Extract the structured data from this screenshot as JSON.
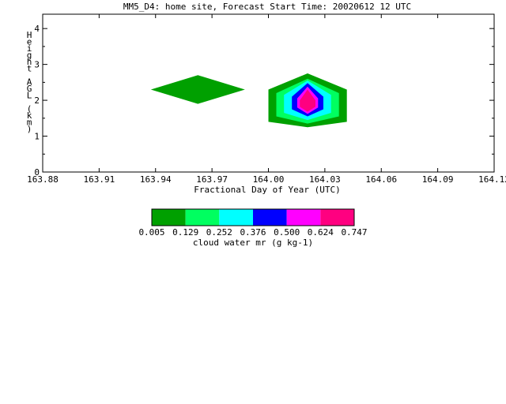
{
  "chart_data": {
    "type": "contour",
    "title": "MM5_D4: home site,  Forecast Start Time: 20020612 12 UTC",
    "xlabel": "Fractional Day of Year (UTC)",
    "ylabel": "Height AGL (km)",
    "xlim": [
      163.88,
      164.12
    ],
    "ylim": [
      0,
      4.4
    ],
    "x_ticks": [
      "163.88",
      "163.91",
      "163.94",
      "163.97",
      "164.00",
      "164.03",
      "164.06",
      "164.09",
      "164.12"
    ],
    "y_ticks": [
      "0",
      "1",
      "2",
      "3",
      "4"
    ],
    "colorbar": {
      "label": "cloud water mr (g kg-1)",
      "tick_labels": [
        "0.005",
        "0.129",
        "0.252",
        "0.376",
        "0.500",
        "0.624",
        "0.747"
      ],
      "colors": [
        "#00a000",
        "#00ff60",
        "#00ffff",
        "#0000ff",
        "#ff00ff",
        "#ff0080"
      ]
    },
    "regions": [
      {
        "level": 0,
        "points": [
          [
            163.9375,
            2.3
          ],
          [
            163.9625,
            2.7
          ],
          [
            163.9875,
            2.3
          ],
          [
            163.9625,
            1.9
          ]
        ]
      },
      {
        "level": 0,
        "points": [
          [
            164.0,
            2.3
          ],
          [
            164.0208,
            2.75
          ],
          [
            164.0417,
            2.3
          ],
          [
            164.0417,
            1.4
          ],
          [
            164.0208,
            1.25
          ],
          [
            164.0,
            1.4
          ]
        ]
      },
      {
        "level": 1,
        "points": [
          [
            164.0042,
            2.2
          ],
          [
            164.0208,
            2.6
          ],
          [
            164.0375,
            2.2
          ],
          [
            164.0375,
            1.55
          ],
          [
            164.0208,
            1.35
          ],
          [
            164.0042,
            1.55
          ]
        ]
      },
      {
        "level": 2,
        "points": [
          [
            164.0083,
            2.15
          ],
          [
            164.0208,
            2.55
          ],
          [
            164.0333,
            2.15
          ],
          [
            164.0333,
            1.65
          ],
          [
            164.0208,
            1.45
          ],
          [
            164.0083,
            1.65
          ]
        ]
      },
      {
        "level": 3,
        "points": [
          [
            164.0125,
            2.1
          ],
          [
            164.0208,
            2.48
          ],
          [
            164.0292,
            2.1
          ],
          [
            164.0292,
            1.75
          ],
          [
            164.0208,
            1.55
          ],
          [
            164.0125,
            1.75
          ]
        ]
      },
      {
        "level": 4,
        "points": [
          [
            164.0153,
            2.05
          ],
          [
            164.0208,
            2.38
          ],
          [
            164.0264,
            2.05
          ],
          [
            164.0264,
            1.8
          ],
          [
            164.0208,
            1.62
          ],
          [
            164.0153,
            1.8
          ]
        ]
      },
      {
        "level": 5,
        "points": [
          [
            164.0167,
            2.0
          ],
          [
            164.0208,
            2.3
          ],
          [
            164.025,
            2.0
          ],
          [
            164.025,
            1.82
          ],
          [
            164.0208,
            1.68
          ],
          [
            164.0167,
            1.82
          ]
        ]
      }
    ]
  }
}
